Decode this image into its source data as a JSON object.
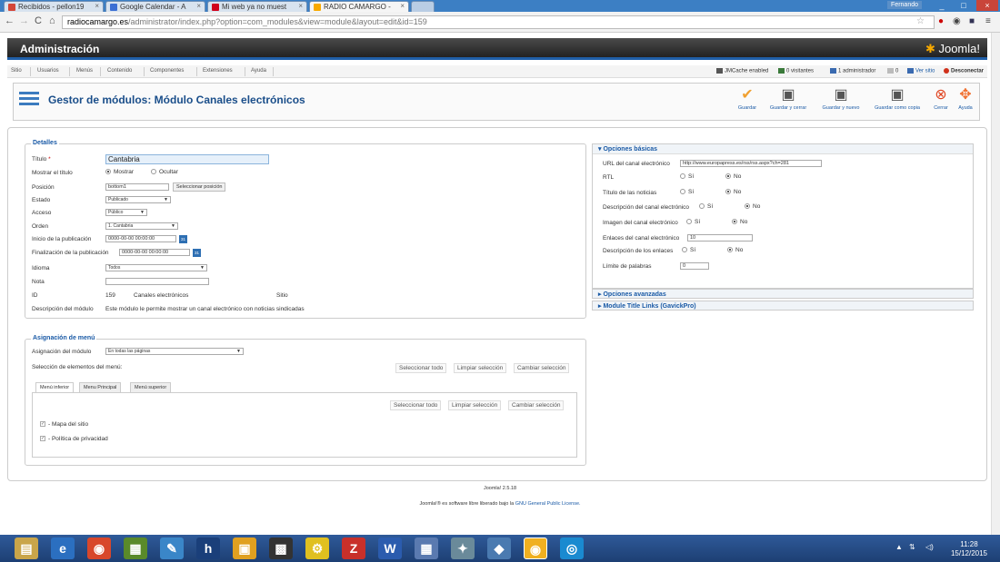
{
  "browser": {
    "tabs": [
      {
        "label": "Recibidos - pellon19",
        "icon_color": "#d44638"
      },
      {
        "label": "Google Calendar - A",
        "icon_color": "#3b6fd4"
      },
      {
        "label": "Mi web ya no muest",
        "icon_color": "#d0021b"
      },
      {
        "label": "RADIO CAMARGO -",
        "icon_color": "#f7a900"
      }
    ],
    "user": "Fernando",
    "url_host": "radiocamargo.es",
    "url_path": "/administrator/index.php?option=com_modules&view=module&layout=edit&id=159"
  },
  "header": {
    "title": "Administración",
    "logo": "Joomla!"
  },
  "menu": {
    "items": [
      "Sitio",
      "Usuarios",
      "Menús",
      "Contenido",
      "Componentes",
      "Extensiones",
      "Ayuda"
    ],
    "status": [
      "JMCache enabled",
      "0 visitantes",
      "1 administrador",
      "0",
      "Ver sitio",
      "Desconectar"
    ]
  },
  "toolbar": {
    "page_title": "Gestor de módulos: Módulo Canales electrónicos",
    "buttons": [
      "Guardar",
      "Guardar y cerrar",
      "Guardar y nuevo",
      "Guardar como copia",
      "Cerrar",
      "Ayuda"
    ]
  },
  "details": {
    "legend": "Detalles",
    "title_label": "Título",
    "title_required": "*",
    "title_value": "Cantabria",
    "show_title_label": "Mostrar el título",
    "show_title_options": [
      "Mostrar",
      "Ocultar"
    ],
    "position_label": "Posición",
    "position_value": "bottom1",
    "position_button": "Seleccionar posición",
    "state_label": "Estado",
    "state_value": "Publicado",
    "access_label": "Acceso",
    "access_value": "Público",
    "order_label": "Orden",
    "order_value": "1. Cantabria",
    "pub_start_label": "Inicio de la publicación",
    "pub_start_value": "0000-00-00 00:00:00",
    "pub_end_label": "Finalización de la publicación",
    "pub_end_value": "0000-00-00 00:00:00",
    "language_label": "Idioma",
    "language_value": "Todos",
    "note_label": "Nota",
    "note_value": "",
    "id_label": "ID",
    "id_value": "159",
    "module_name": "Canales electrónicos",
    "module_client": "Sitio",
    "desc_label": "Descripción del módulo",
    "desc_value": "Este módulo le permite mostrar un canal electrónico con noticias sindicadas"
  },
  "menu_assignment": {
    "legend": "Asignación de menú",
    "assign_label": "Asignación del módulo",
    "assign_value": "En todas las páginas",
    "select_label": "Selección de elementos del menú:",
    "actions": [
      "Seleccionar todo",
      "Limpiar selección",
      "Cambiar selección"
    ],
    "tabs": [
      "Menú inferior",
      "Menu Principal",
      "Menú superior"
    ],
    "items": [
      "- Mapa del sitio",
      "- Política de privacidad"
    ]
  },
  "basic_options": {
    "header": "Opciones básicas",
    "feed_url_label": "URL del canal electrónico",
    "feed_url_value": "http://www.europapress.es/rss/rss.aspx?ch=281",
    "rtl_label": "RTL",
    "feed_title_label": "Título de las noticias",
    "feed_desc_label": "Descripción del canal electrónico",
    "feed_image_label": "Imagen del canal electrónico",
    "items_label": "Enlaces del canal electrónico",
    "items_value": "10",
    "item_desc_label": "Descripción de los enlaces",
    "word_count_label": "Límite de palabras",
    "word_count_value": "0",
    "yes": "Sí",
    "no": "No"
  },
  "panels": [
    "Opciones avanzadas",
    "Module Title Links (GavickPro)"
  ],
  "footer": {
    "version": "Joomla! 2.5.18",
    "license_prefix": "Joomla!® es software libre liberado bajo la",
    "license_link": "GNU General Public License."
  },
  "taskbar": {
    "time": "11:28",
    "date": "15/12/2015"
  }
}
